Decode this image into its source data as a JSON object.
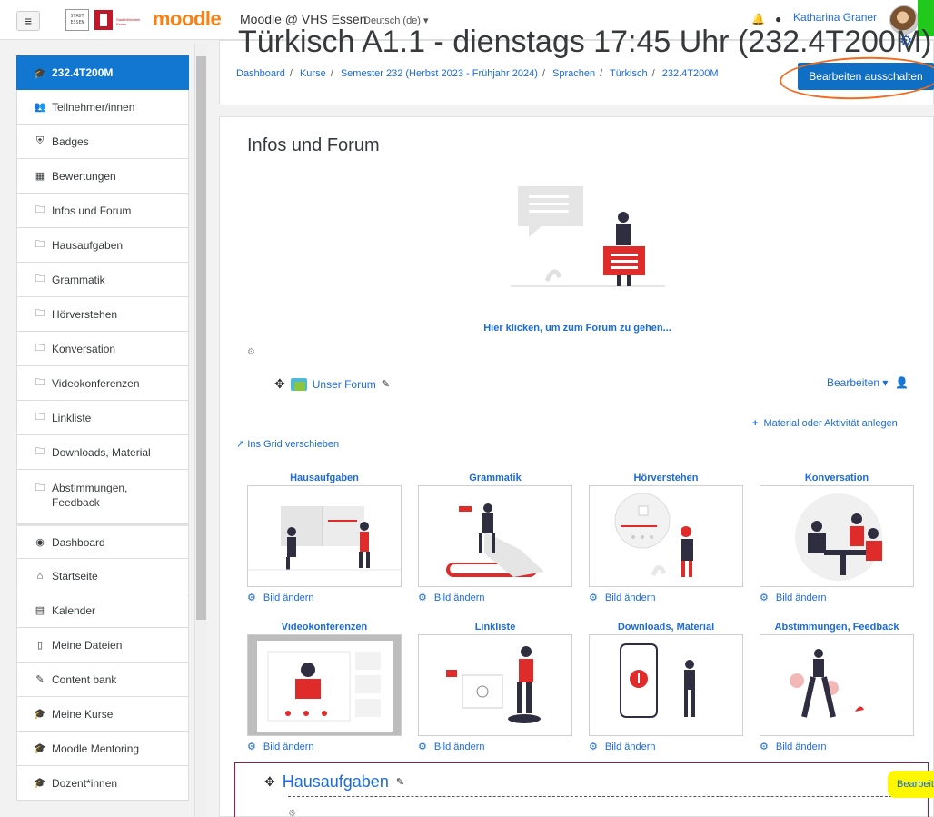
{
  "navbar": {
    "menu_icon": "hamburger-icon",
    "logo_stadt_text": "STADT ESSEN",
    "logo_moodle": "moodle",
    "site_title": "Moodle @ VHS Essen",
    "language": "Deutsch (de) ▾",
    "user_name": "Katharina Graner"
  },
  "sidebar": {
    "items": [
      {
        "label": "232.4T200M",
        "icon": "graduation-cap-icon"
      },
      {
        "label": "Teilnehmer/innen",
        "icon": "users-icon"
      },
      {
        "label": "Badges",
        "icon": "shield-icon"
      },
      {
        "label": "Bewertungen",
        "icon": "table-icon"
      },
      {
        "label": "Infos und Forum",
        "icon": "folder-icon"
      },
      {
        "label": "Hausaufgaben",
        "icon": "folder-icon"
      },
      {
        "label": "Grammatik",
        "icon": "folder-icon"
      },
      {
        "label": "Hörverstehen",
        "icon": "folder-icon"
      },
      {
        "label": "Konversation",
        "icon": "folder-icon"
      },
      {
        "label": "Videokonferenzen",
        "icon": "folder-icon"
      },
      {
        "label": "Linkliste",
        "icon": "folder-icon"
      },
      {
        "label": "Downloads, Material",
        "icon": "folder-icon"
      },
      {
        "label": "Abstimmungen,\nFeedback",
        "icon": "folder-icon"
      },
      {
        "label": "Dashboard",
        "icon": "dashboard-icon"
      },
      {
        "label": "Startseite",
        "icon": "home-icon"
      },
      {
        "label": "Kalender",
        "icon": "calendar-icon"
      },
      {
        "label": "Meine Dateien",
        "icon": "file-icon"
      },
      {
        "label": "Content bank",
        "icon": "brush-icon"
      },
      {
        "label": "Meine Kurse",
        "icon": "graduation-cap-icon"
      },
      {
        "label": "Moodle Mentoring",
        "icon": "graduation-cap-icon"
      },
      {
        "label": "Dozent*innen",
        "icon": "graduation-cap-icon"
      }
    ]
  },
  "header": {
    "course_title": "Türkisch A1.1 - dienstags 17:45 Uhr (232.4T200M)",
    "breadcrumb": [
      "Dashboard",
      "Kurse",
      "Semester 232 (Herbst 2023 - Frühjahr 2024)",
      "Sprachen",
      "Türkisch",
      "232.4T200M"
    ],
    "edit_button": "Bearbeiten ausschalten"
  },
  "main": {
    "section_title": "Infos und Forum",
    "forum_link": "Hier klicken, um zum Forum zu gehen...",
    "forum_name": "Unser Forum",
    "edit_dropdown": "Bearbeiten ▾",
    "add_activity": "Material oder Aktivität anlegen",
    "grid_move": "Ins Grid verschieben",
    "tiles": [
      {
        "title": "Hausaufgaben",
        "change": "Bild ändern"
      },
      {
        "title": "Grammatik",
        "change": "Bild ändern"
      },
      {
        "title": "Hörverstehen",
        "change": "Bild ändern"
      },
      {
        "title": "Konversation",
        "change": "Bild ändern"
      },
      {
        "title": "Videokonferenzen",
        "change": "Bild ändern"
      },
      {
        "title": "Linkliste",
        "change": "Bild ändern"
      },
      {
        "title": "Downloads, Material",
        "change": "Bild ändern"
      },
      {
        "title": "Abstimmungen, Feedback",
        "change": "Bild ändern"
      }
    ],
    "next_section_title": "Hausaufgaben",
    "next_section_edit": "Bearbeiten"
  },
  "colors": {
    "primary": "#0f6fc5",
    "link": "#1b6bd9",
    "accent_red": "#e02b2b",
    "highlight_orange": "#f26b1d",
    "highlight_yellow": "#fff700",
    "green_box": "#21c91c"
  }
}
